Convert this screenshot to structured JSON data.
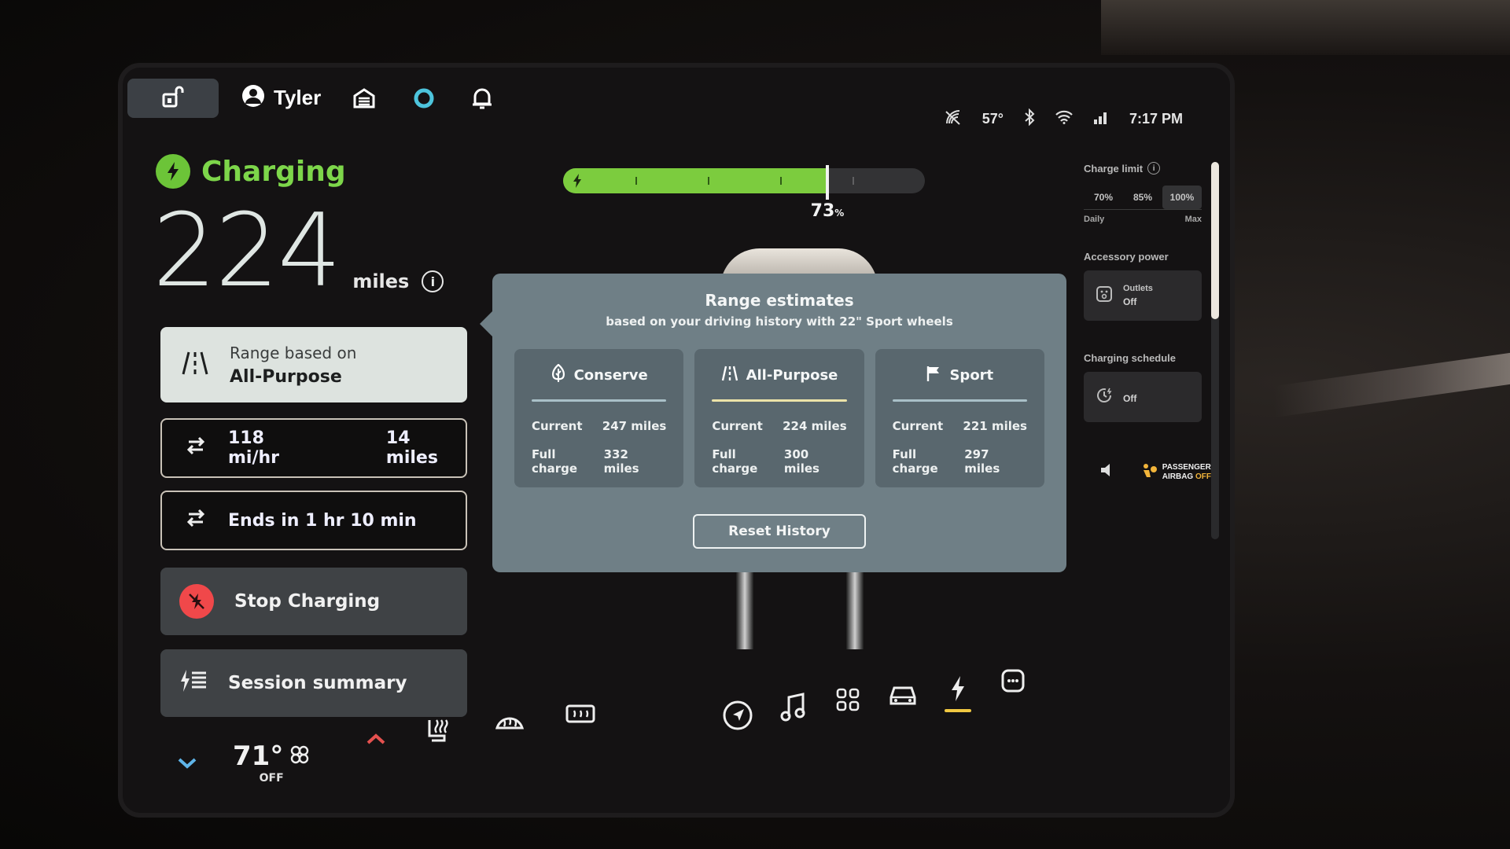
{
  "topbar": {
    "profile_name": "Tyler",
    "icons": [
      "unlock-icon",
      "profile-icon",
      "garage-icon",
      "assistant-icon",
      "notification-bell-icon"
    ]
  },
  "status_bar": {
    "temperature": "57°",
    "time": "7:17 PM",
    "icons": [
      "connectivity-off-icon",
      "bluetooth-icon",
      "wifi-icon",
      "cellular-icon"
    ]
  },
  "charging": {
    "status_label": "Charging",
    "range_value": "224",
    "range_unit": "miles",
    "range_info_label": "i",
    "range_based_label": "Range based on",
    "range_mode": "All-Purpose",
    "rate": "118 mi/hr",
    "miles_added": "14 miles",
    "ends_in": "Ends in 1 hr 10 min",
    "stop_label": "Stop Charging",
    "summary_label": "Session summary",
    "charge_percent_value": 73,
    "charge_percent_label": "73",
    "charge_percent_suffix": "%",
    "colors": {
      "charging_green": "#7ccc3e",
      "stop_red": "#f0484a"
    }
  },
  "range_estimates": {
    "title": "Range estimates",
    "subtitle": "based on your driving history with 22\" Sport wheels",
    "modes": [
      {
        "name": "Conserve",
        "icon": "leaf-icon",
        "current_label": "Current",
        "current": "247 miles",
        "full_label": "Full charge",
        "full": "332 miles",
        "selected": false
      },
      {
        "name": "All-Purpose",
        "icon": "road-icon",
        "current_label": "Current",
        "current": "224 miles",
        "full_label": "Full charge",
        "full": "300 miles",
        "selected": true
      },
      {
        "name": "Sport",
        "icon": "flag-icon",
        "current_label": "Current",
        "current": "221 miles",
        "full_label": "Full charge",
        "full": "297 miles",
        "selected": false
      }
    ],
    "reset_label": "Reset History"
  },
  "right_panel": {
    "charge_limit_label": "Charge limit",
    "charge_limit_options": [
      "70%",
      "85%",
      "100%"
    ],
    "charge_limit_selected": "100%",
    "daily_label": "Daily",
    "max_label": "Max",
    "accessory_power_label": "Accessory power",
    "outlets_label": "Outlets",
    "outlets_value": "Off",
    "charging_schedule_label": "Charging schedule",
    "charging_schedule_value": "Off"
  },
  "dock": {
    "climate_temp": "71°",
    "climate_state": "OFF",
    "items": [
      "navigation-icon",
      "music-icon",
      "apps-icon",
      "vehicle-icon",
      "charging-icon",
      "camera-icon"
    ],
    "active_item": "charging-icon",
    "airbag_label_1": "PASSENGER",
    "airbag_label_2": "AIRBAG",
    "airbag_state": "OFF"
  }
}
